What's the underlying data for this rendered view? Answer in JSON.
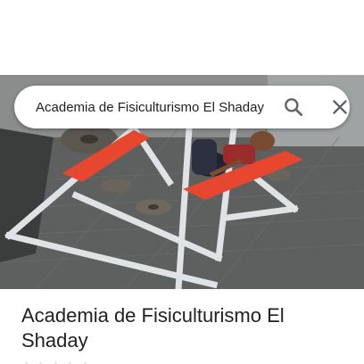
{
  "search": {
    "value": "Academia de Fisiculturismo El Shaday",
    "search_icon": "search-icon",
    "close_icon": "close-icon"
  },
  "place": {
    "name": "Academia de Fisiculturismo El Shaday",
    "rating_icon": "star-icon"
  },
  "colors": {
    "bench_pad": "#e8472f",
    "frame": "#d9dde2",
    "floor": "#5a5d5c",
    "text": "#202124",
    "icon": "#5f6368"
  }
}
